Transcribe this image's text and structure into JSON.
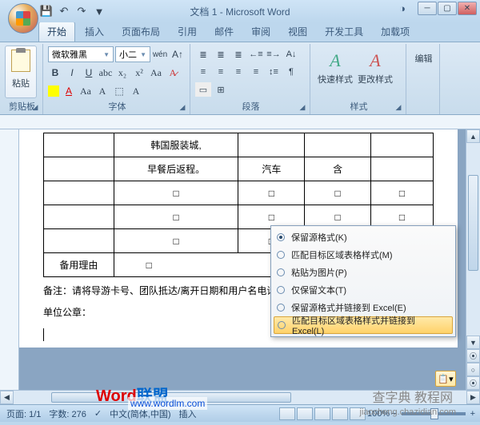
{
  "title": "文档 1 - Microsoft Word",
  "tabs": [
    "开始",
    "插入",
    "页面布局",
    "引用",
    "邮件",
    "审阅",
    "视图",
    "开发工具",
    "加载项"
  ],
  "clipboard": {
    "paste": "粘贴",
    "label": "剪贴板"
  },
  "font": {
    "name": "微软雅黑",
    "size": "小二",
    "label": "字体"
  },
  "paragraph": {
    "label": "段落"
  },
  "styles": {
    "quick": "快速样式",
    "change": "更改样式",
    "label": "样式"
  },
  "editing": {
    "label": "编辑"
  },
  "table": {
    "rows": [
      [
        "",
        "韩国服装城,",
        "",
        "",
        ""
      ],
      [
        "",
        "早餐后返程。",
        "汽车",
        "含",
        ""
      ],
      [
        "",
        "□",
        "□",
        "□",
        "□"
      ],
      [
        "",
        "□",
        "□",
        "□",
        "□"
      ],
      [
        "",
        "□",
        "□",
        "□",
        "□"
      ],
      [
        "备用理由",
        "□",
        "",
        "",
        ""
      ]
    ]
  },
  "note1": "备注：请将导游卡号、团队抵达/离开日期和用户名电话报",
  "note2": "单位公章：",
  "context_menu": {
    "items": [
      "保留源格式(K)",
      "匹配目标区域表格样式(M)",
      "粘贴为图片(P)",
      "仅保留文本(T)",
      "保留源格式并链接到 Excel(E)",
      "匹配目标区域表格样式并链接到 Excel(L)"
    ],
    "selected": 0,
    "highlighted": 5
  },
  "status": {
    "page": "页面: 1/1",
    "words": "字数: 276",
    "lang": "中文(简体,中国)",
    "insert": "插入",
    "zoom": "100%"
  },
  "watermark": {
    "t1": "Word",
    "t2": "联盟",
    "link": "www.wordlm.com",
    "r1": "查字典 教程网",
    "r2": "jiaocheng.chazidian.com"
  }
}
